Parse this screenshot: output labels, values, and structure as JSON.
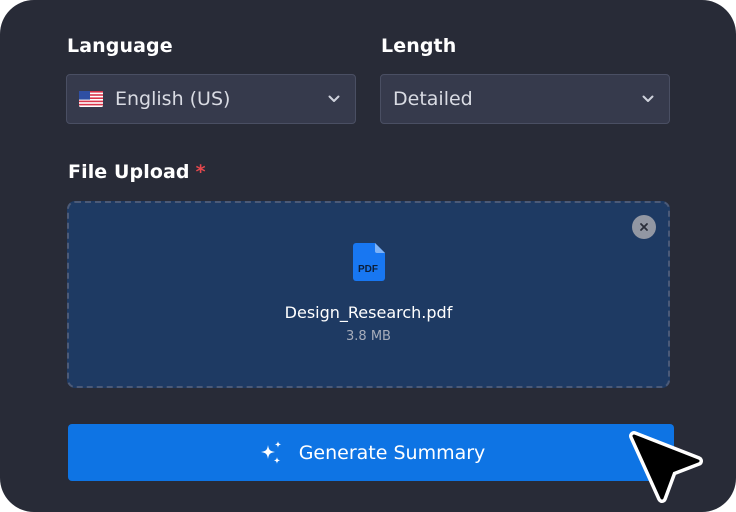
{
  "language": {
    "label": "Language",
    "selected": "English (US)",
    "flag_icon": "us-flag-icon"
  },
  "length": {
    "label": "Length",
    "selected": "Detailed"
  },
  "upload": {
    "label": "File Upload",
    "required_mark": "*",
    "file_name": "Design_Research.pdf",
    "file_size": "3.8 MB",
    "file_type_badge": "PDF"
  },
  "action": {
    "generate_label": "Generate Summary",
    "icon": "sparkles-icon"
  },
  "colors": {
    "background": "#282b37",
    "field": "#363a4c",
    "dropzone": "#1e3a63",
    "accent": "#0e74e4",
    "required": "#e5484d"
  }
}
